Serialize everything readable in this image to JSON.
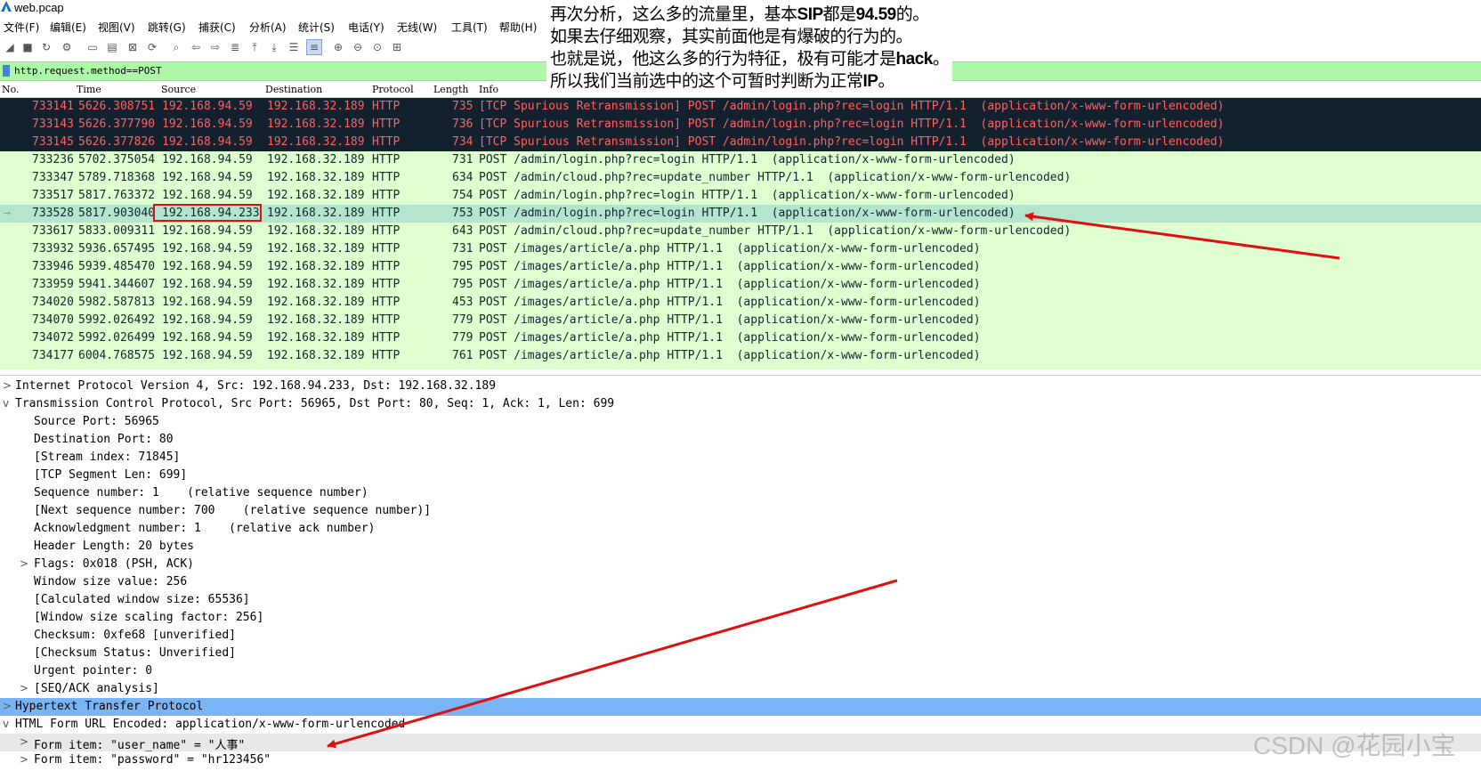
{
  "window": {
    "title": "web.pcap"
  },
  "menu": [
    "文件(F)",
    "编辑(E)",
    "视图(V)",
    "跳转(G)",
    "捕获(C)",
    "分析(A)",
    "统计(S)",
    "电话(Y)",
    "无线(W)",
    "工具(T)",
    "帮助(H)"
  ],
  "toolbar_icons": [
    "shark-fin-start-icon",
    "stop-icon",
    "restart-icon",
    "options-gear-icon",
    "open-folder-icon",
    "save-icon",
    "close-file-icon",
    "reload-icon",
    "find-icon",
    "back-arrow-icon",
    "forward-arrow-icon",
    "goto-packet-icon",
    "first-packet-icon",
    "last-packet-icon",
    "autoscroll-icon",
    "colorize-icon",
    "zoom-in-icon",
    "zoom-out-icon",
    "zoom-normal-icon",
    "resize-columns-icon"
  ],
  "filter": {
    "value": "http.request.method==POST"
  },
  "columns": [
    "No.",
    "Time",
    "Source",
    "Destination",
    "Protocol",
    "Length",
    "Info"
  ],
  "packets": [
    {
      "no": "733141",
      "time": "5626.308751",
      "src": "192.168.94.59",
      "dst": "192.168.32.189",
      "proto": "HTTP",
      "len": "735",
      "info": "[TCP Spurious Retransmission] POST /admin/login.php?rec=login HTTP/1.1  (application/x-www-form-urlencoded)"
    },
    {
      "no": "733143",
      "time": "5626.377790",
      "src": "192.168.94.59",
      "dst": "192.168.32.189",
      "proto": "HTTP",
      "len": "736",
      "info": "[TCP Spurious Retransmission] POST /admin/login.php?rec=login HTTP/1.1  (application/x-www-form-urlencoded)"
    },
    {
      "no": "733145",
      "time": "5626.377826",
      "src": "192.168.94.59",
      "dst": "192.168.32.189",
      "proto": "HTTP",
      "len": "734",
      "info": "[TCP Spurious Retransmission] POST /admin/login.php?rec=login HTTP/1.1  (application/x-www-form-urlencoded)"
    },
    {
      "no": "733236",
      "time": "5702.375054",
      "src": "192.168.94.59",
      "dst": "192.168.32.189",
      "proto": "HTTP",
      "len": "731",
      "info": "POST /admin/login.php?rec=login HTTP/1.1  (application/x-www-form-urlencoded)"
    },
    {
      "no": "733347",
      "time": "5789.718368",
      "src": "192.168.94.59",
      "dst": "192.168.32.189",
      "proto": "HTTP",
      "len": "634",
      "info": "POST /admin/cloud.php?rec=update_number HTTP/1.1  (application/x-www-form-urlencoded)"
    },
    {
      "no": "733517",
      "time": "5817.763372",
      "src": "192.168.94.59",
      "dst": "192.168.32.189",
      "proto": "HTTP",
      "len": "754",
      "info": "POST /admin/login.php?rec=login HTTP/1.1  (application/x-www-form-urlencoded)"
    },
    {
      "no": "733528",
      "time": "5817.903040",
      "src": "192.168.94.233",
      "dst": "192.168.32.189",
      "proto": "HTTP",
      "len": "753",
      "info": "POST /admin/login.php?rec=login HTTP/1.1  (application/x-www-form-urlencoded)"
    },
    {
      "no": "733617",
      "time": "5833.009311",
      "src": "192.168.94.59",
      "dst": "192.168.32.189",
      "proto": "HTTP",
      "len": "643",
      "info": "POST /admin/cloud.php?rec=update_number HTTP/1.1  (application/x-www-form-urlencoded)"
    },
    {
      "no": "733932",
      "time": "5936.657495",
      "src": "192.168.94.59",
      "dst": "192.168.32.189",
      "proto": "HTTP",
      "len": "731",
      "info": "POST /images/article/a.php HTTP/1.1  (application/x-www-form-urlencoded)"
    },
    {
      "no": "733946",
      "time": "5939.485470",
      "src": "192.168.94.59",
      "dst": "192.168.32.189",
      "proto": "HTTP",
      "len": "795",
      "info": "POST /images/article/a.php HTTP/1.1  (application/x-www-form-urlencoded)"
    },
    {
      "no": "733959",
      "time": "5941.344607",
      "src": "192.168.94.59",
      "dst": "192.168.32.189",
      "proto": "HTTP",
      "len": "795",
      "info": "POST /images/article/a.php HTTP/1.1  (application/x-www-form-urlencoded)"
    },
    {
      "no": "734020",
      "time": "5982.587813",
      "src": "192.168.94.59",
      "dst": "192.168.32.189",
      "proto": "HTTP",
      "len": "453",
      "info": "POST /images/article/a.php HTTP/1.1  (application/x-www-form-urlencoded)"
    },
    {
      "no": "734070",
      "time": "5992.026492",
      "src": "192.168.94.59",
      "dst": "192.168.32.189",
      "proto": "HTTP",
      "len": "779",
      "info": "POST /images/article/a.php HTTP/1.1  (application/x-www-form-urlencoded)"
    },
    {
      "no": "734072",
      "time": "5992.026499",
      "src": "192.168.94.59",
      "dst": "192.168.32.189",
      "proto": "HTTP",
      "len": "779",
      "info": "POST /images/article/a.php HTTP/1.1  (application/x-www-form-urlencoded)"
    },
    {
      "no": "734177",
      "time": "6004.768575",
      "src": "192.168.94.59",
      "dst": "192.168.32.189",
      "proto": "HTTP",
      "len": "761",
      "info": "POST /images/article/a.php HTTP/1.1  (application/x-www-form-urlencoded)"
    }
  ],
  "details": [
    {
      "text": "Internet Protocol Version 4, Src: 192.168.94.233, Dst: 192.168.32.189",
      "arrow": ">"
    },
    {
      "text": "Transmission Control Protocol, Src Port: 56965, Dst Port: 80, Seq: 1, Ack: 1, Len: 699",
      "arrow": "v"
    },
    {
      "text": "Source Port: 56965",
      "arrow": ""
    },
    {
      "text": "Destination Port: 80",
      "arrow": ""
    },
    {
      "text": "[Stream index: 71845]",
      "arrow": ""
    },
    {
      "text": "[TCP Segment Len: 699]",
      "arrow": ""
    },
    {
      "text": "Sequence number: 1    (relative sequence number)",
      "arrow": ""
    },
    {
      "text": "[Next sequence number: 700    (relative sequence number)]",
      "arrow": ""
    },
    {
      "text": "Acknowledgment number: 1    (relative ack number)",
      "arrow": ""
    },
    {
      "text": "Header Length: 20 bytes",
      "arrow": ""
    },
    {
      "text": "Flags: 0x018 (PSH, ACK)",
      "arrow": ">"
    },
    {
      "text": "Window size value: 256",
      "arrow": ""
    },
    {
      "text": "[Calculated window size: 65536]",
      "arrow": ""
    },
    {
      "text": "[Window size scaling factor: 256]",
      "arrow": ""
    },
    {
      "text": "Checksum: 0xfe68 [unverified]",
      "arrow": ""
    },
    {
      "text": "[Checksum Status: Unverified]",
      "arrow": ""
    },
    {
      "text": "Urgent pointer: 0",
      "arrow": ""
    },
    {
      "text": "[SEQ/ACK analysis]",
      "arrow": ">"
    },
    {
      "text": "Hypertext Transfer Protocol",
      "arrow": ">"
    },
    {
      "text": "HTML Form URL Encoded: application/x-www-form-urlencoded",
      "arrow": "v"
    },
    {
      "text": "Form item: \"user_name\" = \"人事\"",
      "arrow": ">"
    },
    {
      "text": "Form item: \"password\" = \"hr123456\"",
      "arrow": ">"
    }
  ],
  "annotation": {
    "line1_a": "再次分析，这么多的流量里，基本",
    "line1_b": "SIP",
    "line1_c": "都是",
    "line1_d": "94.59",
    "line1_e": "的。",
    "line2": "如果去仔细观察，其实前面他是有爆破的行为的。",
    "line3_a": "也就是说，他这么多的行为特征，极有可能才是",
    "line3_b": "hack",
    "line3_c": "。",
    "line4_a": "所以我们当前选中的这个可暂时判断为正常",
    "line4_b": "IP",
    "line4_c": "。"
  },
  "watermark": "CSDN @花园小宝",
  "colors": {
    "arrow": "#e01010",
    "filter_bg": "#aff7a8",
    "row_dark": "#13212e",
    "row_green": "#e0ffd0",
    "row_selected": "#b4e5cf",
    "http_highlight": "#7ab4f5"
  }
}
